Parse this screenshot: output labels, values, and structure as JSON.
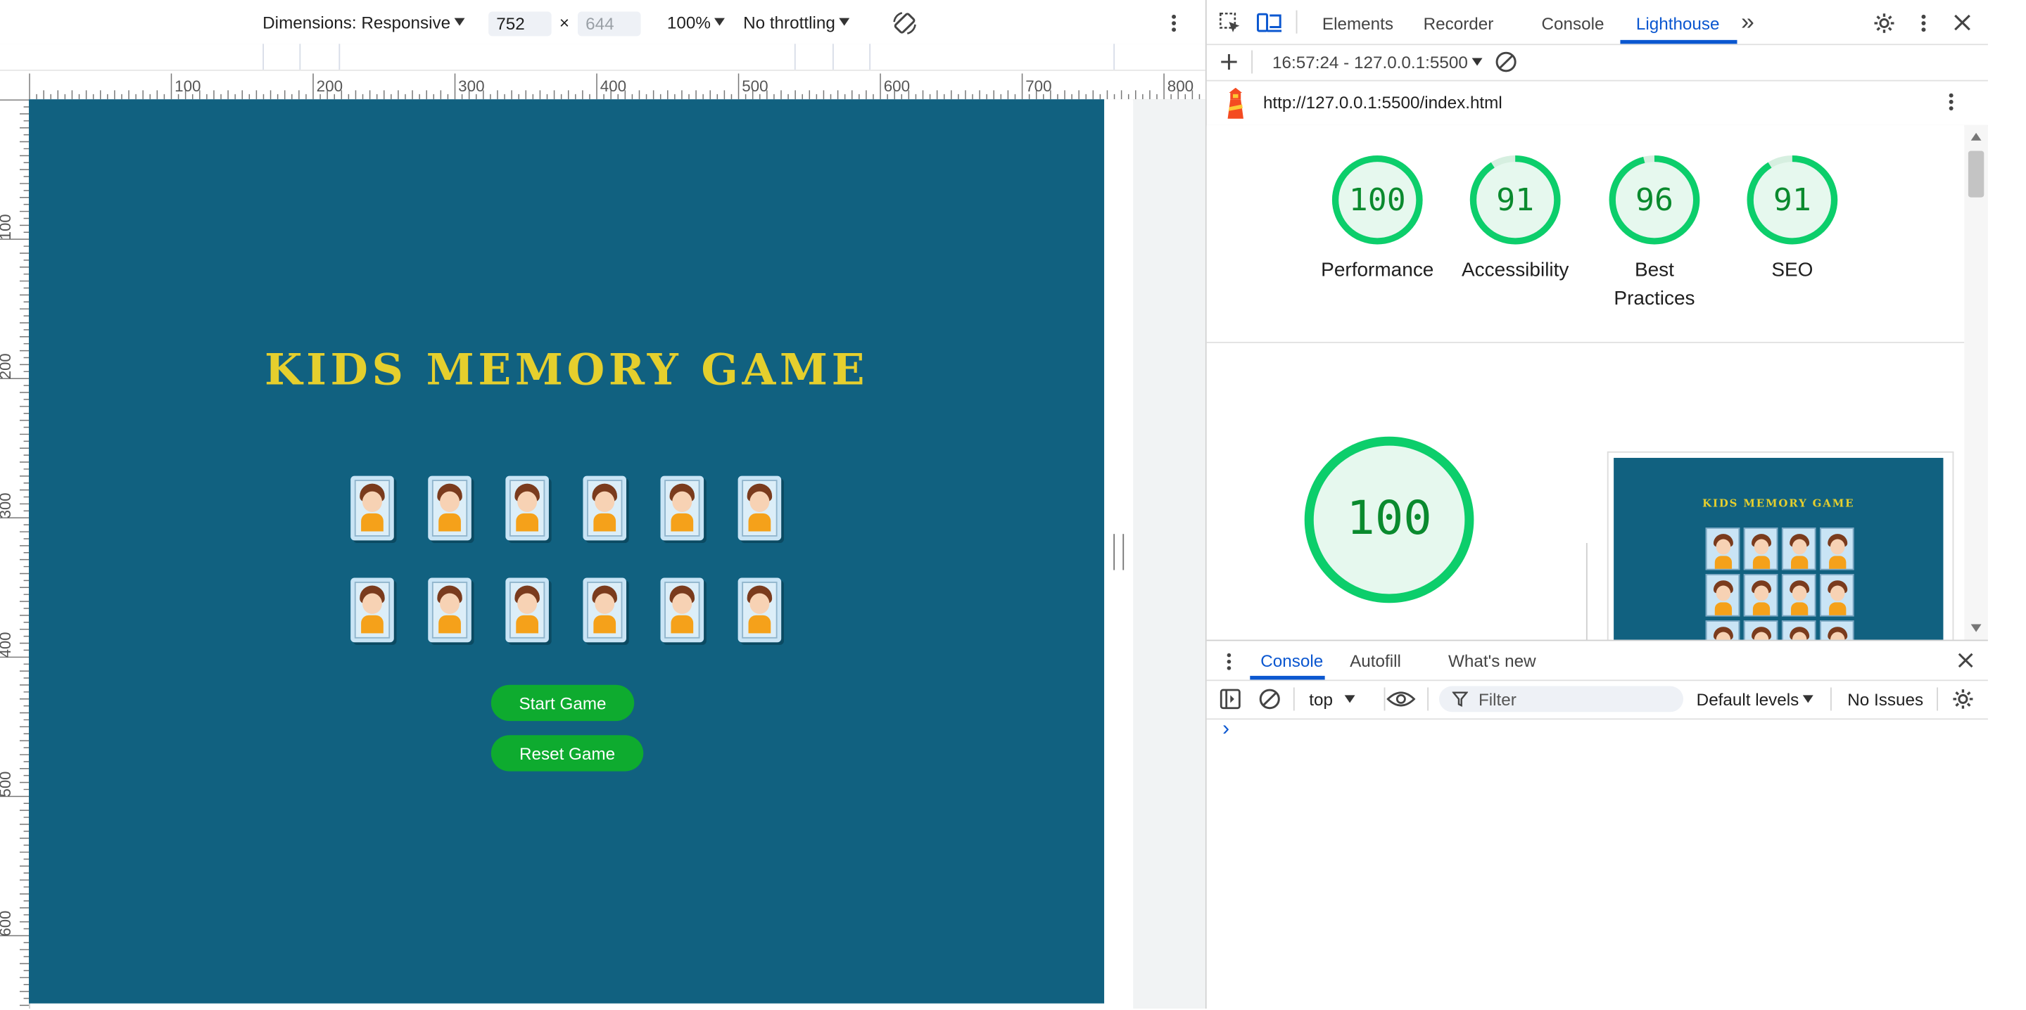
{
  "device_toolbar": {
    "dimensions_label": "Dimensions: Responsive",
    "width_value": "752",
    "times": "×",
    "height_value": "644",
    "zoom": "100%",
    "throttling": "No throttling"
  },
  "ruler": {
    "top_numbers": [
      "100",
      "200",
      "300",
      "400",
      "500",
      "600",
      "700",
      "800"
    ],
    "left_numbers": [
      "100",
      "200",
      "300",
      "400",
      "500",
      "600"
    ]
  },
  "game": {
    "title": "KIDS MEMORY GAME",
    "start_button": "Start Game",
    "reset_button": "Reset Game",
    "card_rows": 2,
    "cards_per_row": 6
  },
  "devtools": {
    "tabs": [
      "Elements",
      "Recorder",
      "Console",
      "Lighthouse"
    ],
    "active_tab": "Lighthouse",
    "more_tabs": "»",
    "lighthouse": {
      "report_selector": "16:57:24 - 127.0.0.1:5500",
      "url": "http://127.0.0.1:5500/index.html",
      "scores": [
        {
          "value": "100",
          "label": "Performance",
          "score": 100
        },
        {
          "value": "91",
          "label": "Accessibility",
          "score": 91
        },
        {
          "value": "96",
          "label_line1": "Best",
          "label_line2": "Practices",
          "score": 96
        },
        {
          "value": "91",
          "label": "SEO",
          "score": 91
        }
      ],
      "big_score": "100",
      "thumbnail_title": "KIDS MEMORY GAME"
    },
    "drawer": {
      "tabs": [
        "Console",
        "Autofill",
        "What's new"
      ],
      "active_tab": "Console",
      "context": "top",
      "filter_placeholder": "Filter",
      "levels": "Default levels",
      "issues": "No Issues",
      "prompt": "›"
    }
  },
  "colors": {
    "viewport_bg": "#116180",
    "title_yellow": "#e5cf2d",
    "button_green": "#0eab2f",
    "score_green": "#0cce6b",
    "accent_blue": "#0b57d0"
  }
}
